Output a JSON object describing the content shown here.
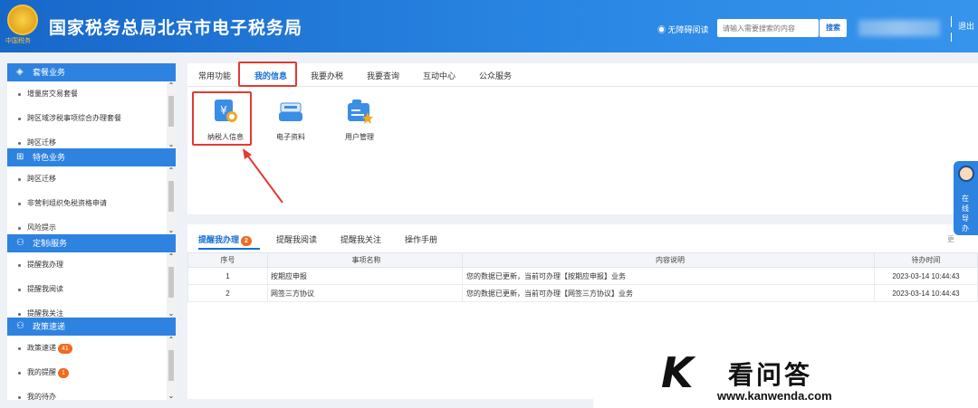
{
  "header": {
    "title": "国家税务总局北京市电子税务局",
    "emblem_sub": "中国税务",
    "accessibility": "无障碍阅读",
    "search_placeholder": "请输入需要搜索的内容",
    "search_button": "搜索",
    "logout": "退出"
  },
  "sidebar": [
    {
      "title": "套餐业务",
      "icon": "layers-icon",
      "items": [
        {
          "label": "增量房交易套餐"
        },
        {
          "label": "跨区域涉税事项综合办理套餐"
        },
        {
          "label": "跨区迁移"
        }
      ]
    },
    {
      "title": "特色业务",
      "icon": "grid-icon",
      "items": [
        {
          "label": "跨区迁移"
        },
        {
          "label": "非营利组织免税资格申请"
        },
        {
          "label": "风险提示"
        }
      ]
    },
    {
      "title": "定制i服务",
      "icon": "user-icon",
      "items": [
        {
          "label": "提醒我办理"
        },
        {
          "label": "提醒我阅读"
        },
        {
          "label": "提醒我关注"
        }
      ]
    },
    {
      "title": "政策速递",
      "icon": "user-icon",
      "items": [
        {
          "label": "政策速递",
          "badge": "41"
        },
        {
          "label": "我的提醒",
          "badge": "1"
        },
        {
          "label": "我的待办"
        }
      ]
    }
  ],
  "top_tabs": [
    "常用功能",
    "我的信息",
    "我要办税",
    "我要查询",
    "互动中心",
    "公众服务"
  ],
  "tiles": [
    {
      "label": "纳税人信息",
      "icon": "taxpayer-info-icon"
    },
    {
      "label": "电子资料",
      "icon": "e-documents-icon"
    },
    {
      "label": "用户管理",
      "icon": "user-management-icon"
    }
  ],
  "bottom_tabs": {
    "items": [
      {
        "label": "提醒我办理",
        "badge": "2"
      },
      {
        "label": "提醒我阅读"
      },
      {
        "label": "提醒我关注"
      },
      {
        "label": "操作手册"
      }
    ],
    "more": "更"
  },
  "table": {
    "headers": [
      "序号",
      "事项名称",
      "内容说明",
      "待办时间"
    ],
    "rows": [
      [
        "1",
        "按期应申报",
        "您的数据已更新，当前可办理【按期应申报】业务",
        "2023-03-14 10:44:43"
      ],
      [
        "2",
        "网签三方协议",
        "您的数据已更新，当前可办理【网签三方协议】业务",
        "2023-03-14 10:44:43"
      ]
    ]
  },
  "float_guide": "在线导办",
  "watermark": {
    "logo": "K",
    "title": "看问答",
    "url": "www.kanwenda.com"
  },
  "colors": {
    "header": "#2a87e4",
    "accent": "#1a6ed6",
    "highlight_box": "#e23b33",
    "badge": "#f06a1f"
  }
}
